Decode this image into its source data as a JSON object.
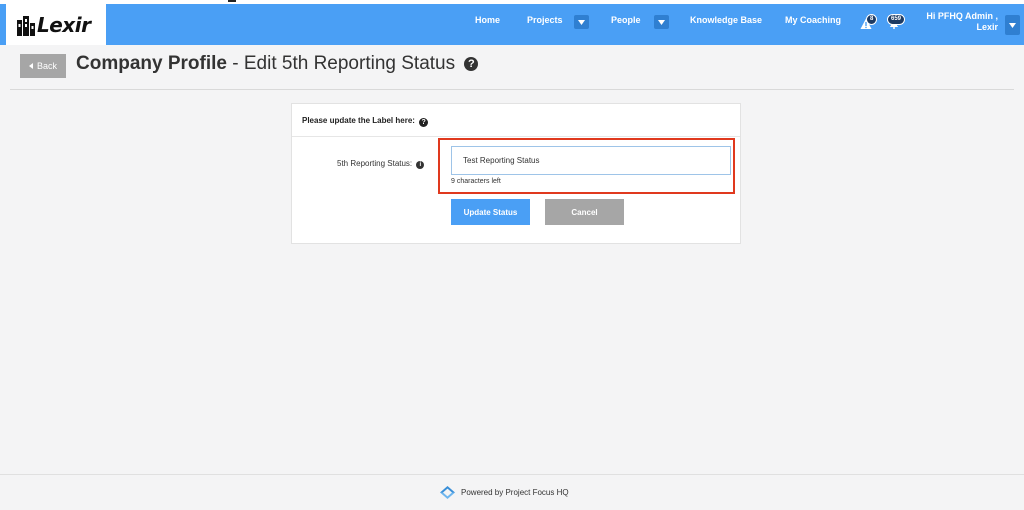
{
  "brand": {
    "logo_text": "Lexir"
  },
  "nav": {
    "home": "Home",
    "projects": "Projects",
    "people": "People",
    "knowledge_base": "Knowledge Base",
    "my_coaching": "My Coaching"
  },
  "notifications": {
    "alerts_count": "8",
    "updates_count": "659"
  },
  "user": {
    "greeting": "Hi PFHQ Admin ,",
    "company": "Lexir"
  },
  "page": {
    "back_label": "Back",
    "title_bold": "Company Profile",
    "title_rest": " - Edit 5th Reporting Status"
  },
  "form": {
    "header_label": "Please update the Label here:",
    "field_label": "5th Reporting Status:",
    "field_value": "Test Reporting Status",
    "chars_left": "9 characters left",
    "update_label": "Update Status",
    "cancel_label": "Cancel"
  },
  "footer": {
    "powered_by": "Powered by Project Focus HQ"
  },
  "colors": {
    "primary": "#4a9ff5",
    "dark_blue": "#2f7fd1",
    "highlight": "#e0391e",
    "muted_button": "#a6a6a6"
  },
  "icons": [
    "building-logo-icon",
    "chevron-down-icon",
    "warning-icon",
    "bell-icon",
    "chevron-left-icon",
    "help-icon",
    "info-icon",
    "project-focus-logo-icon"
  ]
}
